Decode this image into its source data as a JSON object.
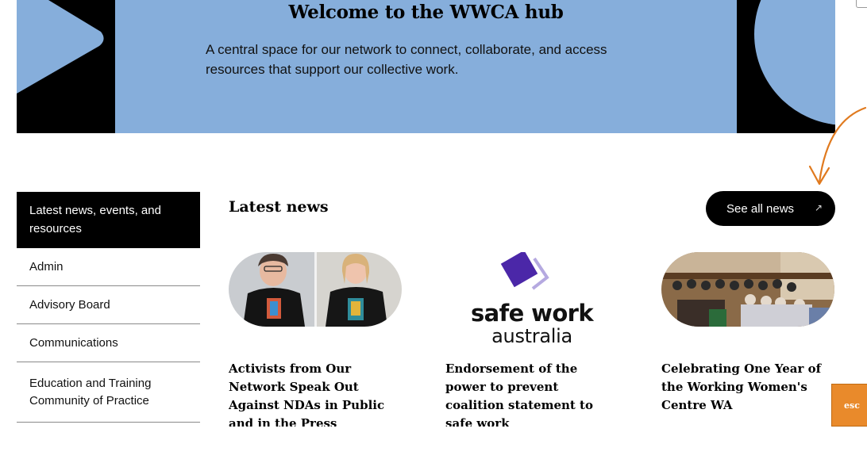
{
  "hero": {
    "title": "Welcome to the WWCA hub",
    "description": "A central space for our network to connect, collaborate, and access resources that support our collective work."
  },
  "sidebar": {
    "items": [
      {
        "label": "Latest news, events, and resources",
        "active": true
      },
      {
        "label": "Admin"
      },
      {
        "label": "Advisory Board"
      },
      {
        "label": "Communications"
      },
      {
        "label": "Education and Training Community of Practice"
      }
    ]
  },
  "news": {
    "heading": "Latest news",
    "see_all_label": "See all news",
    "see_all_icon": "arrow-up-right-icon",
    "cards": [
      {
        "title": "Activists from Our Network Speak Out Against NDAs in Public and in the Press",
        "image": "two-women-in-black-tshirts-photo"
      },
      {
        "title": "Endorsement of the power to prevent coalition statement to safe work",
        "image": "safe-work-australia-logo",
        "logo_line1": "safe work",
        "logo_line2": "australia"
      },
      {
        "title": "Celebrating One Year of the Working Women's Centre WA",
        "image": "audience-in-hall-photo"
      }
    ]
  },
  "esc_button": {
    "label": "esc"
  },
  "colors": {
    "hero_bg": "#86aedb",
    "esc_orange": "#e98a2b",
    "annotation_arrow": "#e07a1f"
  }
}
